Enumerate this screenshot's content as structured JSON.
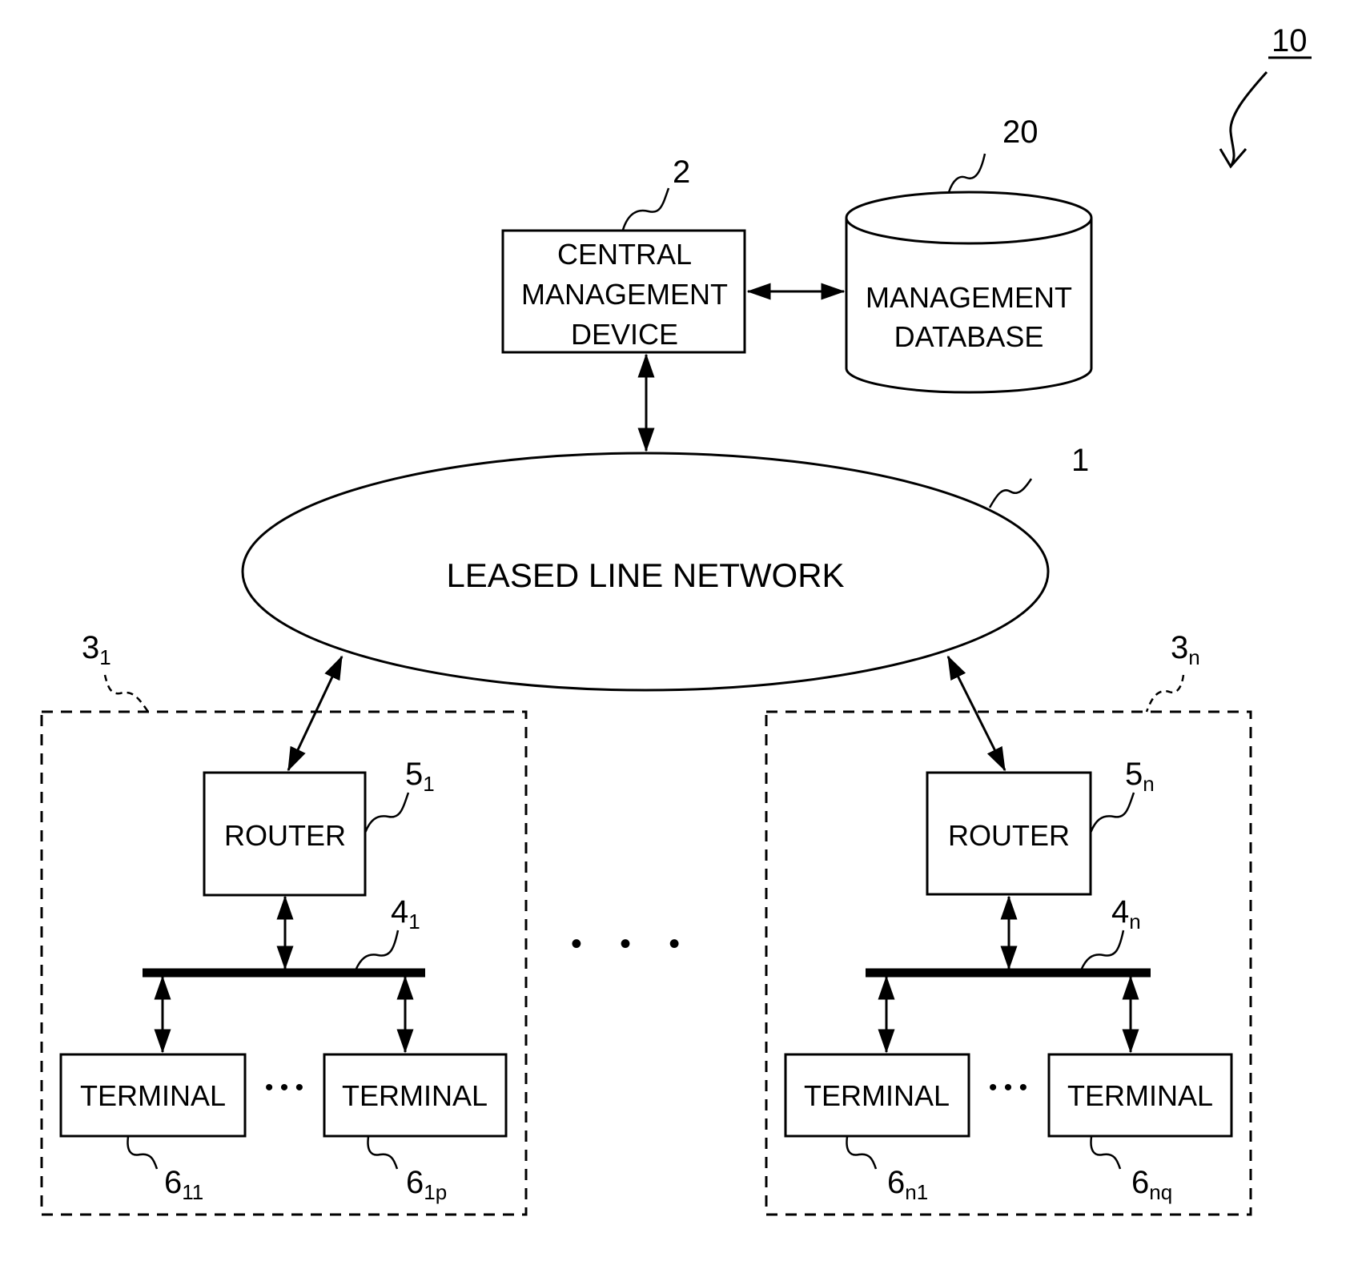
{
  "figure": {
    "system_ref": "10",
    "central_device": {
      "lines": [
        "CENTRAL",
        "MANAGEMENT",
        "DEVICE"
      ],
      "ref": "2"
    },
    "database": {
      "lines": [
        "MANAGEMENT",
        "DATABASE"
      ],
      "ref": "20"
    },
    "network": {
      "label": "LEASED LINE NETWORK",
      "ref": "1"
    },
    "ellipsis": "• • •",
    "sites": [
      {
        "ref_main": "3",
        "ref_sub": "1",
        "router": {
          "label": "ROUTER",
          "ref_main": "5",
          "ref_sub": "1"
        },
        "bus": {
          "ref_main": "4",
          "ref_sub": "1"
        },
        "terminals": [
          {
            "label": "TERMINAL",
            "ref_main": "6",
            "ref_sub": "11"
          },
          {
            "label": "TERMINAL",
            "ref_main": "6",
            "ref_sub": "1p"
          }
        ],
        "terminal_ellipsis": "• • •"
      },
      {
        "ref_main": "3",
        "ref_sub": "n",
        "router": {
          "label": "ROUTER",
          "ref_main": "5",
          "ref_sub": "n"
        },
        "bus": {
          "ref_main": "4",
          "ref_sub": "n"
        },
        "terminals": [
          {
            "label": "TERMINAL",
            "ref_main": "6",
            "ref_sub": "n1"
          },
          {
            "label": "TERMINAL",
            "ref_main": "6",
            "ref_sub": "nq"
          }
        ],
        "terminal_ellipsis": "• • •"
      }
    ]
  }
}
